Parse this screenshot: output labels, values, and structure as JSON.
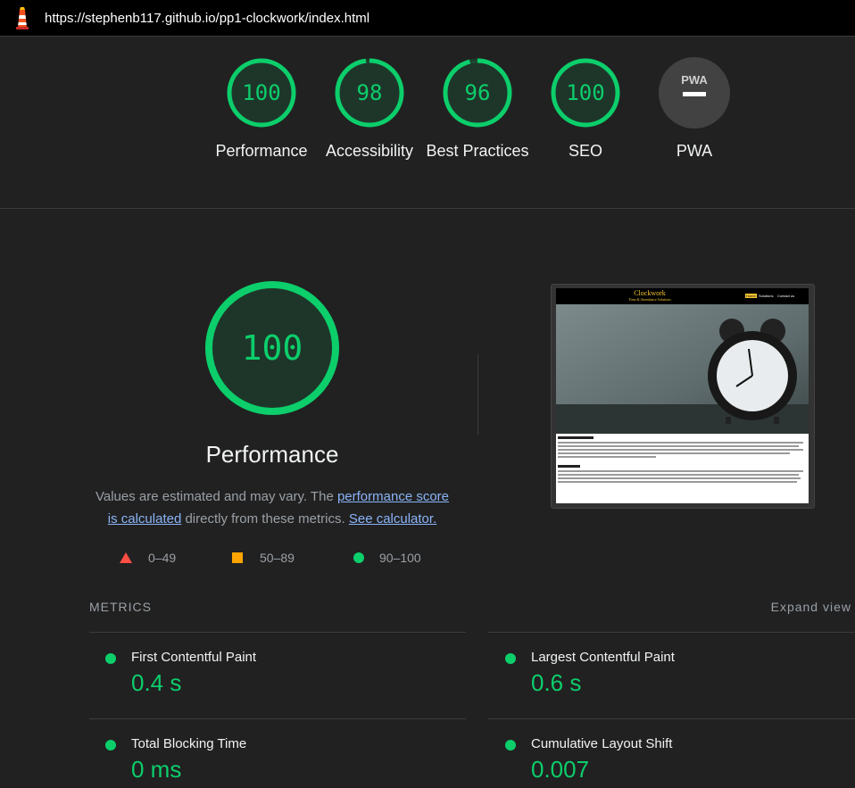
{
  "url": "https://stephenb117.github.io/pp1-clockwork/index.html",
  "colors": {
    "pass": "#0cce6b",
    "average": "#ffa400",
    "fail": "#ff4e42",
    "link": "#8ab4f8"
  },
  "gauges": [
    {
      "score": "100",
      "label": "Performance",
      "value": 100
    },
    {
      "score": "98",
      "label": "Accessibility",
      "value": 98
    },
    {
      "score": "96",
      "label": "Best Practices",
      "value": 96
    },
    {
      "score": "100",
      "label": "SEO",
      "value": 100
    }
  ],
  "pwa": {
    "badge": "PWA",
    "label": "PWA"
  },
  "performance": {
    "score": "100",
    "title": "Performance",
    "desc_prefix": "Values are estimated and may vary. The ",
    "desc_link": "performance score is calculated",
    "desc_middle": " directly from these metrics. ",
    "desc_calc": "See calculator."
  },
  "legend": {
    "fail": "0–49",
    "average": "50–89",
    "pass": "90–100"
  },
  "screenshot": {
    "site_title": "Clockwork",
    "site_subtitle": "Time & Attendance Solutions",
    "nav": [
      "Home",
      "Solutions",
      "Contact us"
    ]
  },
  "metrics": {
    "heading": "METRICS",
    "expand": "Expand view",
    "items": [
      {
        "name": "First Contentful Paint",
        "value": "0.4 s"
      },
      {
        "name": "Largest Contentful Paint",
        "value": "0.6 s"
      },
      {
        "name": "Total Blocking Time",
        "value": "0 ms"
      },
      {
        "name": "Cumulative Layout Shift",
        "value": "0.007"
      }
    ]
  }
}
